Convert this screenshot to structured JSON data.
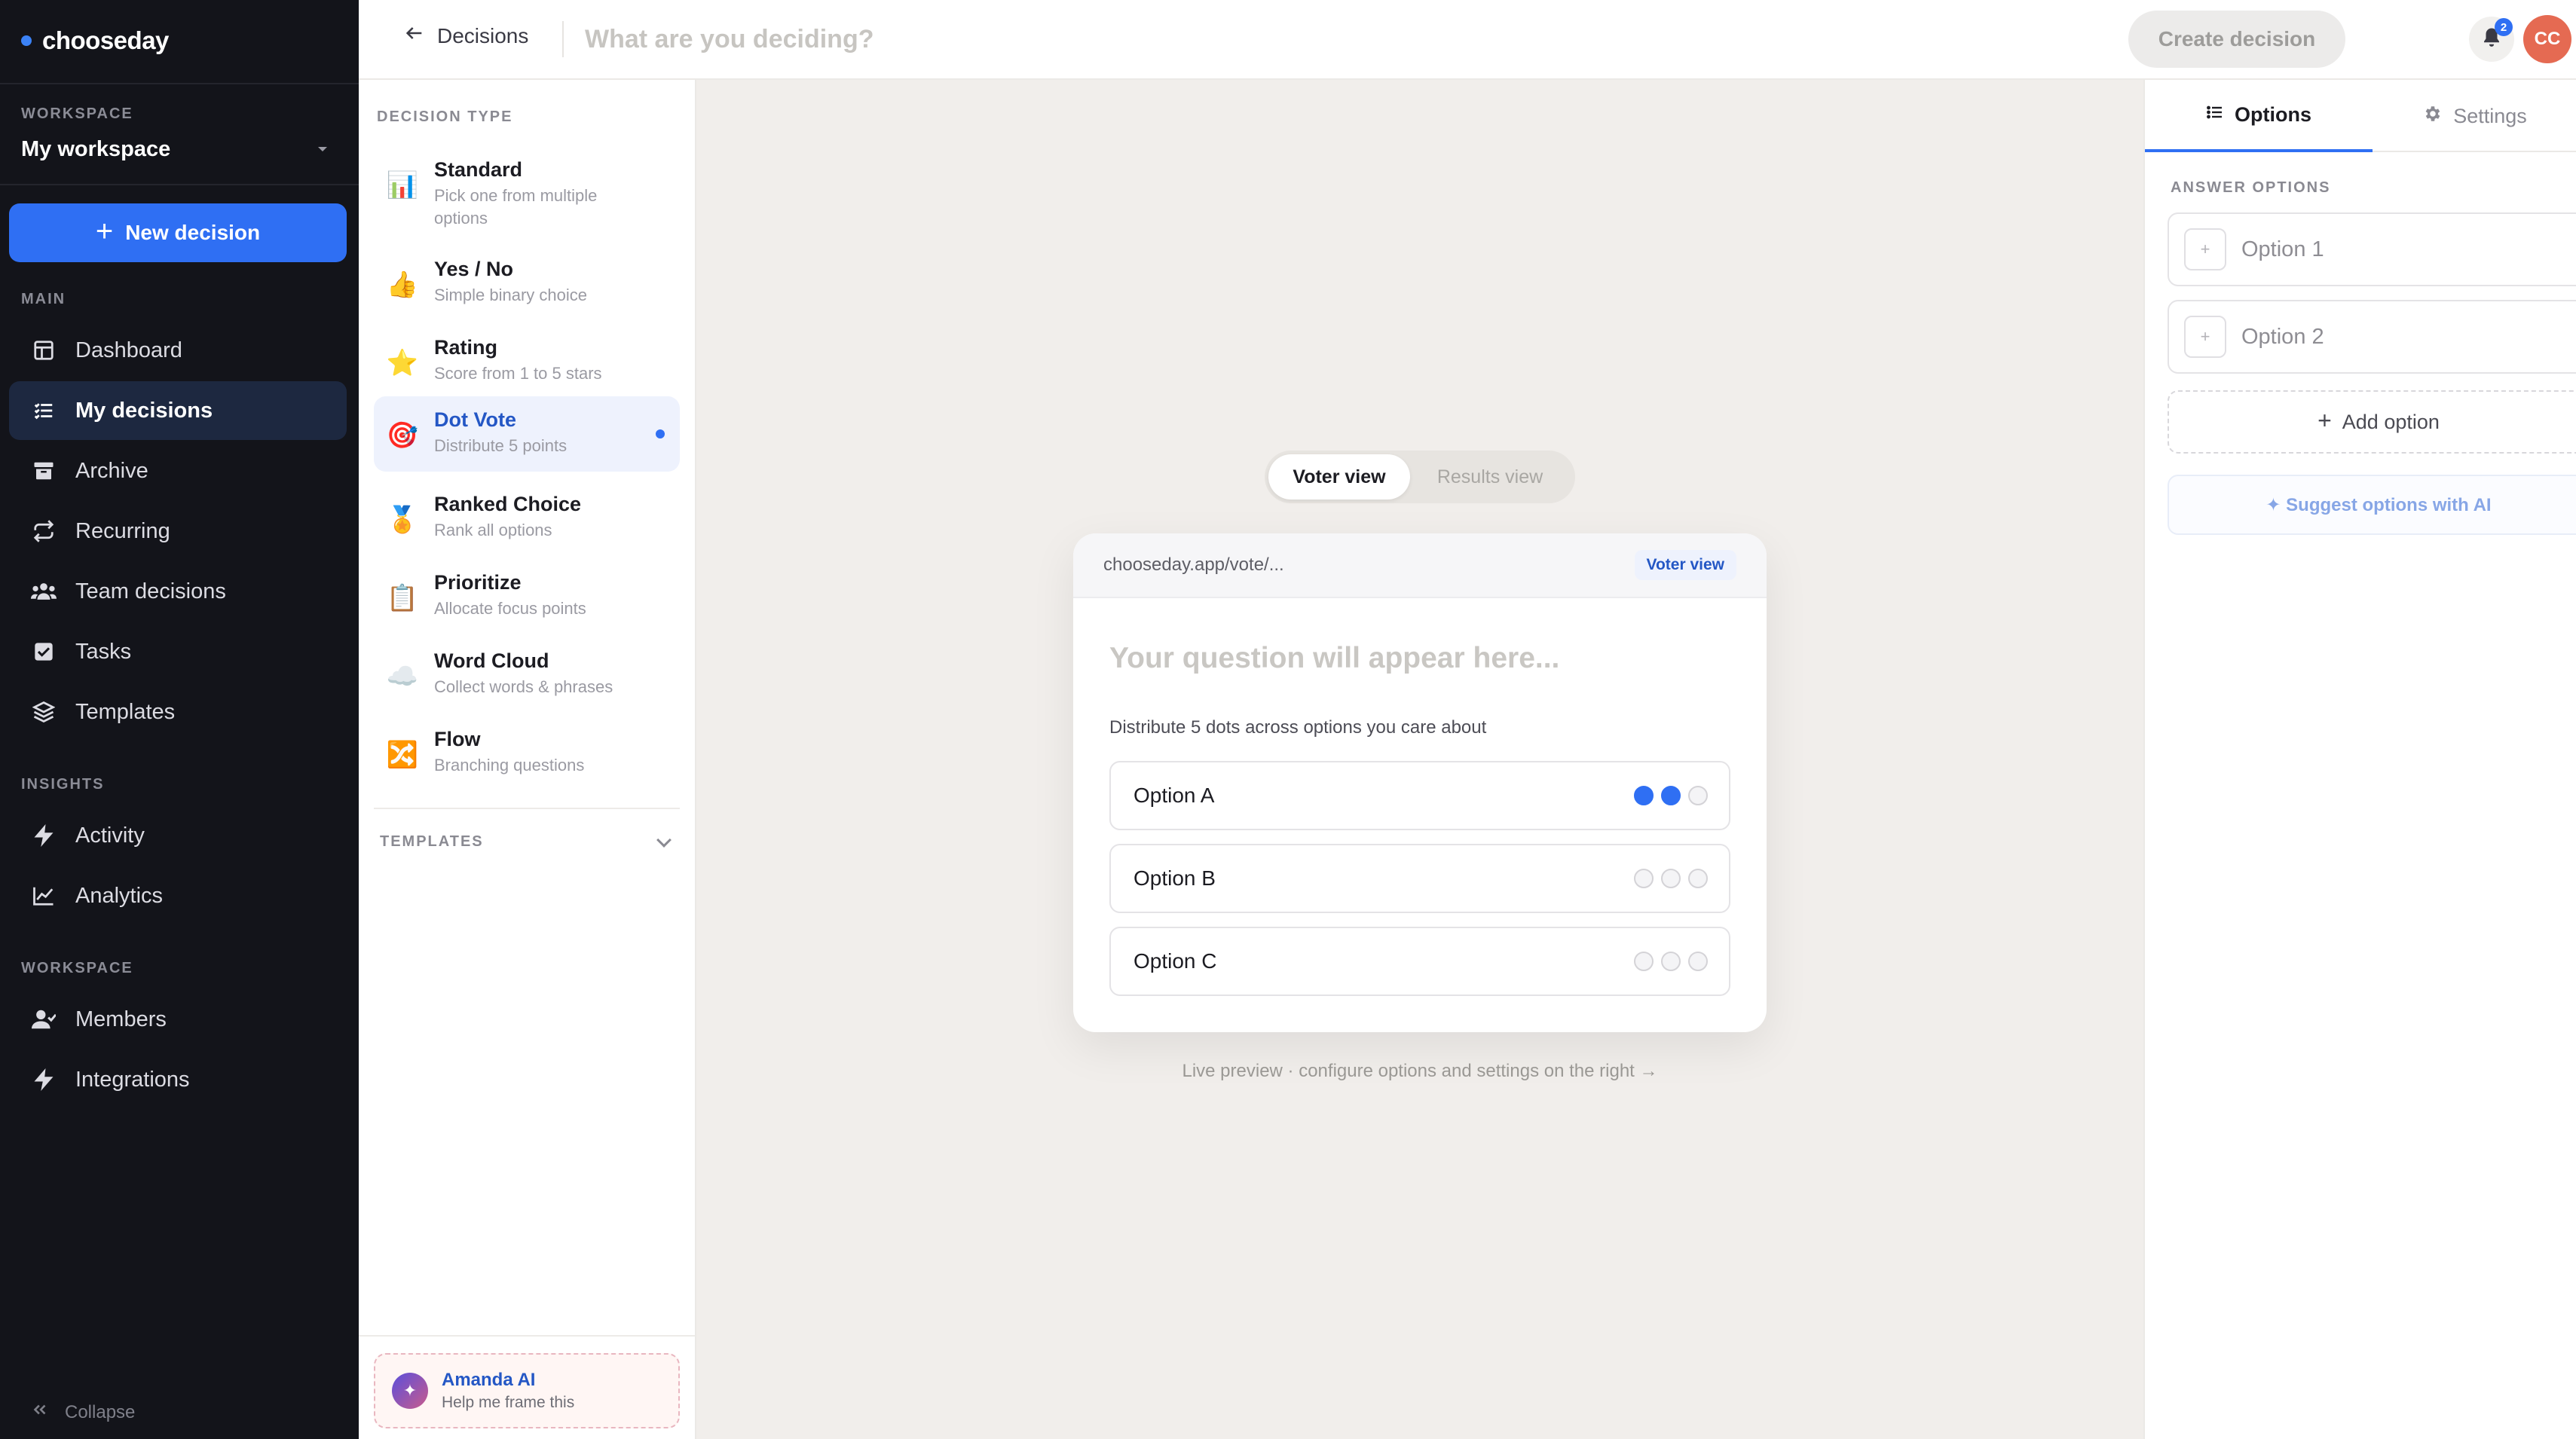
{
  "brand": {
    "name": "chooseday",
    "accent": "#3b82f6"
  },
  "sidebar": {
    "workspace_label": "WORKSPACE",
    "workspace_name": "My workspace",
    "new_button": "New decision",
    "main_label": "MAIN",
    "main_items": [
      {
        "label": "Dashboard",
        "icon": "dashboard-icon"
      },
      {
        "label": "My decisions",
        "icon": "list-icon",
        "active": true
      },
      {
        "label": "Archive",
        "icon": "archive-icon"
      },
      {
        "label": "Recurring",
        "icon": "repeat-icon"
      },
      {
        "label": "Team decisions",
        "icon": "team-icon"
      },
      {
        "label": "Tasks",
        "icon": "checkbox-icon"
      },
      {
        "label": "Templates",
        "icon": "layers-icon"
      }
    ],
    "insights_label": "INSIGHTS",
    "insights_items": [
      {
        "label": "Activity",
        "icon": "bolt-icon"
      },
      {
        "label": "Analytics",
        "icon": "chart-line-icon"
      }
    ],
    "workspace_section_label": "WORKSPACE",
    "workspace_items": [
      {
        "label": "Members",
        "icon": "user-icon"
      },
      {
        "label": "Integrations",
        "icon": "bolt-icon"
      }
    ],
    "collapse": "Collapse"
  },
  "topbar": {
    "back_label": "Decisions",
    "title_placeholder": "What are you deciding?",
    "create_button": "Create decision",
    "notification_count": "2",
    "avatar_initials": "CC"
  },
  "decision_types": {
    "heading": "DECISION TYPE",
    "items": [
      {
        "name": "Standard",
        "desc": "Pick one from multiple options",
        "emoji": "📊"
      },
      {
        "name": "Yes / No",
        "desc": "Simple binary choice",
        "emoji": "👍"
      },
      {
        "name": "Rating",
        "desc": "Score from 1 to 5 stars",
        "emoji": "⭐"
      },
      {
        "name": "Dot Vote",
        "desc": "Distribute 5 points",
        "emoji": "🎯",
        "active": true
      },
      {
        "name": "Ranked Choice",
        "desc": "Rank all options",
        "emoji": "🏅"
      },
      {
        "name": "Prioritize",
        "desc": "Allocate focus points",
        "emoji": "📋"
      },
      {
        "name": "Word Cloud",
        "desc": "Collect words & phrases",
        "emoji": "☁️"
      },
      {
        "name": "Flow",
        "desc": "Branching questions",
        "emoji": "🔀"
      }
    ],
    "templates_label": "TEMPLATES",
    "assistant": {
      "name": "Amanda AI",
      "subtitle": "Help me frame this",
      "icon": "✦"
    }
  },
  "preview": {
    "toggle_on": "Voter view",
    "toggle_off": "Results view",
    "url": "chooseday.app/vote/...",
    "chip": "Voter view",
    "question_placeholder": "Your question will appear here...",
    "hint": "Distribute 5 dots across options you care about",
    "options": [
      {
        "label": "Option A",
        "filled": 2
      },
      {
        "label": "Option B",
        "filled": 0
      },
      {
        "label": "Option C",
        "filled": 0
      }
    ],
    "dots_per_option": 3,
    "note": "Live preview · configure options and settings on the right →"
  },
  "right_panel": {
    "tab_options": "Options",
    "tab_settings": "Settings",
    "answer_heading": "ANSWER OPTIONS",
    "answers": [
      {
        "placeholder": "Option 1"
      },
      {
        "placeholder": "Option 2"
      }
    ],
    "add_option": "Add option",
    "suggest": "✦ Suggest options with AI"
  }
}
